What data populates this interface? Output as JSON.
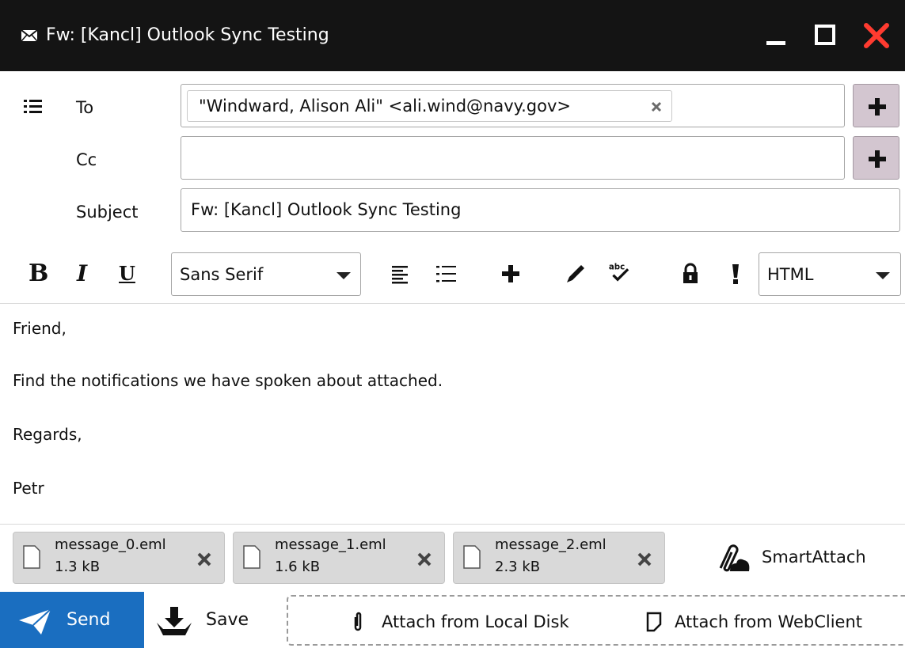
{
  "window": {
    "title": "Fw: [Kancl] Outlook Sync Testing",
    "icons": {
      "title": "envelope-icon",
      "minimize": "minimize-icon",
      "maximize": "maximize-icon",
      "close": "close-icon"
    },
    "close_color": "#ff3b30"
  },
  "header": {
    "to_label": "To",
    "cc_label": "Cc",
    "subject_label": "Subject",
    "to_recipients": [
      "\"Windward, Alison Ali\" <ali.wind@navy.gov>"
    ],
    "cc_value": "",
    "subject_value": "Fw: [Kancl] Outlook Sync Testing"
  },
  "toolbar": {
    "bold": "B",
    "italic": "I",
    "underline": "U",
    "font": "Sans Serif",
    "format": "HTML",
    "icons": [
      "align-left-icon",
      "bullet-list-icon",
      "plus-icon",
      "pencil-icon",
      "spellcheck-icon",
      "lock-icon",
      "priority-icon"
    ]
  },
  "body": {
    "lines": [
      "Friend,",
      "Find the notifications we have spoken about attached.",
      "Regards,",
      "Petr"
    ]
  },
  "attachments": [
    {
      "name": "message_0.eml",
      "size": "1.3 kB"
    },
    {
      "name": "message_1.eml",
      "size": "1.6 kB"
    },
    {
      "name": "message_2.eml",
      "size": "2.3 kB"
    }
  ],
  "smart_attach": "SmartAttach",
  "actions": {
    "send": "Send",
    "save": "Save",
    "attach_local": "Attach from Local Disk",
    "attach_webclient": "Attach from WebClient"
  },
  "colors": {
    "send_bg": "#1a6ec0",
    "titlebar_bg": "#141414",
    "plus_btn_bg": "#d3c6d0"
  }
}
